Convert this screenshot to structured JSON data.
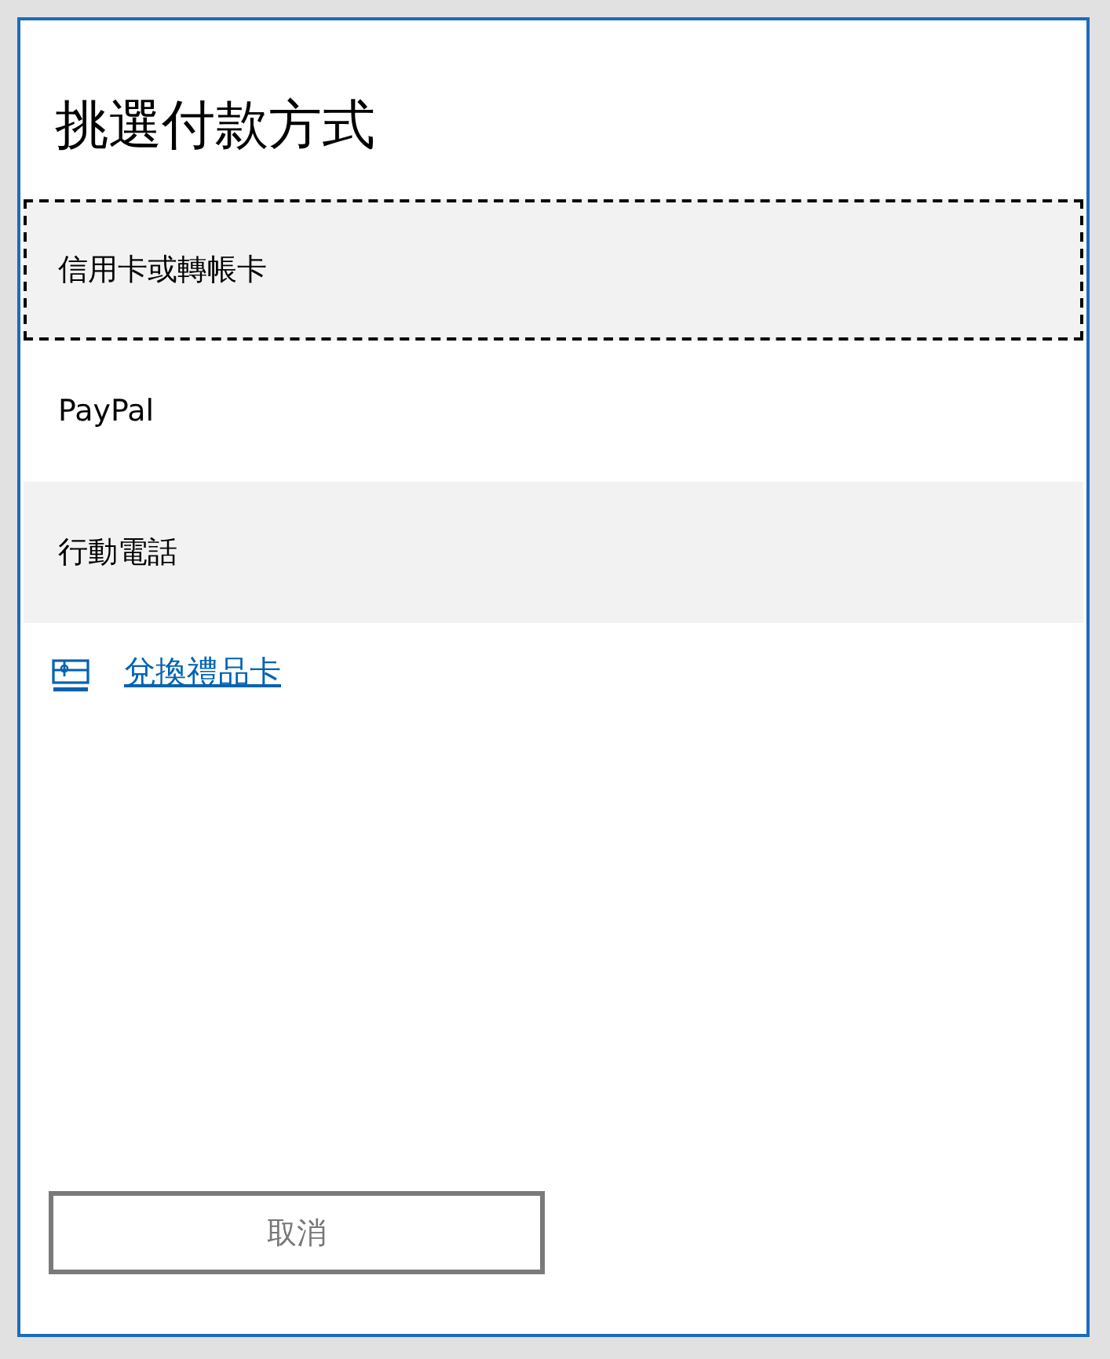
{
  "dialog": {
    "title": "挑選付款方式"
  },
  "payment_options": [
    {
      "label": "信用卡或轉帳卡",
      "focused": true,
      "highlighted": true
    },
    {
      "label": "PayPal",
      "focused": false,
      "highlighted": false
    },
    {
      "label": "行動電話",
      "focused": false,
      "highlighted": true
    }
  ],
  "redeem_link": {
    "label": "兌換禮品卡"
  },
  "buttons": [
    {
      "label": "取消"
    }
  ]
}
